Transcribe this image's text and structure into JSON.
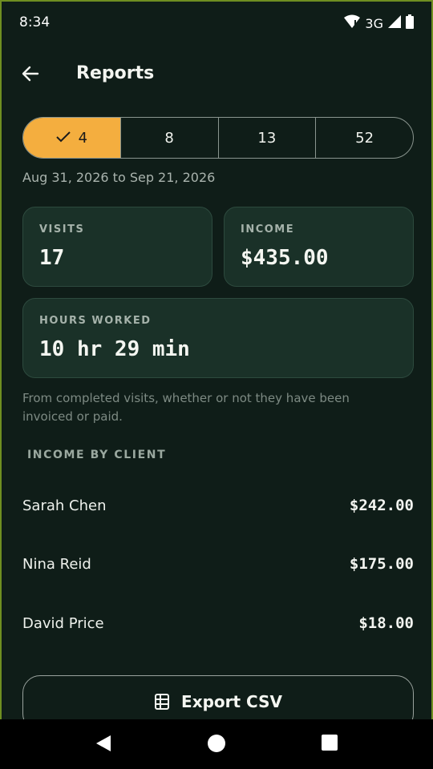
{
  "status_bar": {
    "time": "8:34",
    "network": "3G",
    "icons": [
      "wifi-icon",
      "signal-icon",
      "battery-icon"
    ]
  },
  "app_bar": {
    "title": "Reports",
    "back_icon": "arrow-left-icon"
  },
  "period_selector": {
    "options": [
      {
        "label": "4",
        "selected": true
      },
      {
        "label": "8",
        "selected": false
      },
      {
        "label": "13",
        "selected": false
      },
      {
        "label": "52",
        "selected": false
      }
    ],
    "selected_check_icon": "check-icon"
  },
  "date_range": "Aug 31, 2026 to Sep 21, 2026",
  "stats": {
    "visits": {
      "label": "VISITS",
      "value": "17"
    },
    "income": {
      "label": "INCOME",
      "value": "$435.00"
    },
    "hours": {
      "label": "HOURS WORKED",
      "value": "10 hr 29 min"
    }
  },
  "footnote": "From completed visits, whether or not they have been invoiced or paid.",
  "income_by_client": {
    "header": "INCOME BY CLIENT",
    "rows": [
      {
        "name": "Sarah Chen",
        "amount": "$242.00"
      },
      {
        "name": "Nina Reid",
        "amount": "$175.00"
      },
      {
        "name": "David Price",
        "amount": "$18.00"
      }
    ]
  },
  "export": {
    "label": "Export CSV",
    "icon": "spreadsheet-icon"
  },
  "colors": {
    "background": "#0f1d18",
    "card": "#1a3128",
    "accent": "#f4ae3f",
    "frame": "#6f8e21"
  }
}
